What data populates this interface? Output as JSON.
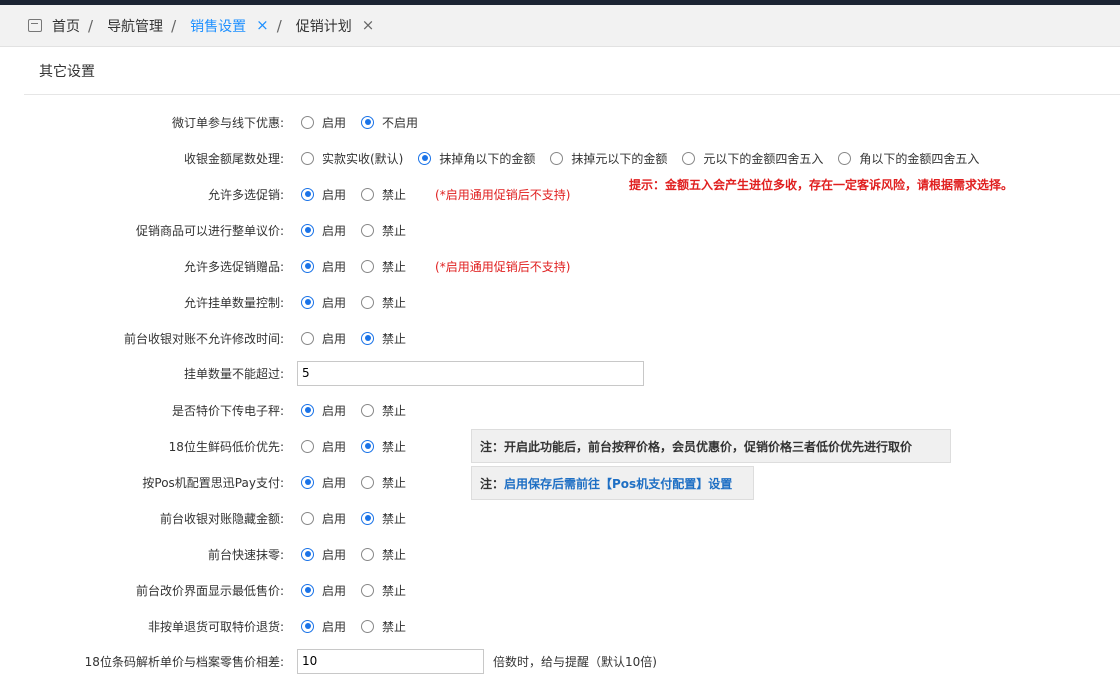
{
  "tabs": {
    "items": [
      {
        "label": "首页"
      },
      {
        "label": "导航管理"
      },
      {
        "label": "销售设置"
      },
      {
        "label": "促销计划"
      }
    ],
    "close_glyph": "×",
    "sep_glyph": "/"
  },
  "section": {
    "title": "其它设置"
  },
  "rows": {
    "r1": {
      "label": "微订单参与线下优惠:",
      "opts": [
        "启用",
        "不启用"
      ],
      "selected": 1
    },
    "r2": {
      "label": "收银金额尾数处理:",
      "opts": [
        "实款实收(默认)",
        "抹掉角以下的金额",
        "抹掉元以下的金额",
        "元以下的金额四舍五入",
        "角以下的金额四舍五入"
      ],
      "selected": 1
    },
    "r3": {
      "label": "允许多选促销:",
      "opts": [
        "启用",
        "禁止"
      ],
      "selected": 0,
      "note": "(*启用通用促销后不支持)"
    },
    "r4": {
      "label": "促销商品可以进行整单议价:",
      "opts": [
        "启用",
        "禁止"
      ],
      "selected": 0
    },
    "r5": {
      "label": "允许多选促销赠品:",
      "opts": [
        "启用",
        "禁止"
      ],
      "selected": 0,
      "note": "(*启用通用促销后不支持)"
    },
    "r6": {
      "label": "允许挂单数量控制:",
      "opts": [
        "启用",
        "禁止"
      ],
      "selected": 0
    },
    "r7": {
      "label": "前台收银对账不允许修改时间:",
      "opts": [
        "启用",
        "禁止"
      ],
      "selected": 1
    },
    "r8": {
      "label": "挂单数量不能超过:",
      "value": "5"
    },
    "r9": {
      "label": "是否特价下传电子秤:",
      "opts": [
        "启用",
        "禁止"
      ],
      "selected": 0
    },
    "r10": {
      "label": "18位生鲜码低价优先:",
      "opts": [
        "启用",
        "禁止"
      ],
      "selected": 1
    },
    "r11": {
      "label": "按Pos机配置思迅Pay支付:",
      "opts": [
        "启用",
        "禁止"
      ],
      "selected": 0
    },
    "r12": {
      "label": "前台收银对账隐藏金额:",
      "opts": [
        "启用",
        "禁止"
      ],
      "selected": 1
    },
    "r13": {
      "label": "前台快速抹零:",
      "opts": [
        "启用",
        "禁止"
      ],
      "selected": 0
    },
    "r14": {
      "label": "前台改价界面显示最低售价:",
      "opts": [
        "启用",
        "禁止"
      ],
      "selected": 0
    },
    "r15": {
      "label": "非按单退货可取特价退货:",
      "opts": [
        "启用",
        "禁止"
      ],
      "selected": 0
    },
    "r16": {
      "label": "18位条码解析单价与档案零售价相差:",
      "value": "10",
      "after": "倍数时，给与提醒（默认10倍)"
    }
  },
  "tip": "提示：金额五入会产生进位多收，存在一定客诉风险，请根据需求选择。",
  "notes": {
    "n1": "注：开启此功能后，前台按秤价格，会员优惠价，促销价格三者低价优先进行取价",
    "n2_prefix": "注：",
    "n2_link": "启用保存后需前往【Pos机支付配置】设置"
  },
  "colors": {
    "accent": "#1a73e8",
    "warning": "#e02020"
  }
}
